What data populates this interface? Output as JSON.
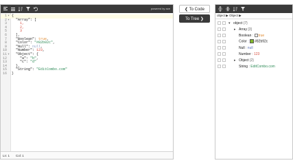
{
  "left": {
    "powered_by": "powered by ace",
    "code_lines": [
      {
        "num": "1",
        "fold": "▾",
        "parts": [
          {
            "t": "{",
            "c": "p"
          }
        ]
      },
      {
        "num": "2",
        "fold": "▾",
        "parts": [
          {
            "t": "  \"Array\": [",
            "c": "k"
          }
        ]
      },
      {
        "num": "3",
        "fold": "",
        "parts": [
          {
            "t": "    1,",
            "c": "n"
          }
        ]
      },
      {
        "num": "4",
        "fold": "",
        "parts": [
          {
            "t": "    2,",
            "c": "n"
          }
        ]
      },
      {
        "num": "5",
        "fold": "",
        "parts": [
          {
            "t": "    3",
            "c": "n"
          }
        ]
      },
      {
        "num": "6",
        "fold": "",
        "parts": [
          {
            "t": "  ],",
            "c": "p"
          }
        ]
      },
      {
        "num": "7",
        "fold": "",
        "parts": [
          {
            "t": "  \"Boolean\": ",
            "c": "k"
          },
          {
            "t": "true",
            "c": "b"
          },
          {
            "t": ",",
            "c": "p"
          }
        ]
      },
      {
        "num": "8",
        "fold": "",
        "parts": [
          {
            "t": "  \"Color\": ",
            "c": "k"
          },
          {
            "t": "\"#82b92c\"",
            "c": "s"
          },
          {
            "t": ",",
            "c": "p"
          }
        ]
      },
      {
        "num": "9",
        "fold": "",
        "parts": [
          {
            "t": "  \"Null\": ",
            "c": "k"
          },
          {
            "t": "null",
            "c": "nl"
          },
          {
            "t": ",",
            "c": "p"
          }
        ]
      },
      {
        "num": "10",
        "fold": "",
        "parts": [
          {
            "t": "  \"Number\": ",
            "c": "k"
          },
          {
            "t": "123",
            "c": "n"
          },
          {
            "t": ",",
            "c": "p"
          }
        ]
      },
      {
        "num": "11",
        "fold": "▾",
        "parts": [
          {
            "t": "  \"Object\": {",
            "c": "k"
          }
        ]
      },
      {
        "num": "12",
        "fold": "",
        "parts": [
          {
            "t": "    \"a\": ",
            "c": "k"
          },
          {
            "t": "\"b\"",
            "c": "s"
          },
          {
            "t": ",",
            "c": "p"
          }
        ]
      },
      {
        "num": "13",
        "fold": "",
        "parts": [
          {
            "t": "    \"c\": ",
            "c": "k"
          },
          {
            "t": "\"d\"",
            "c": "s"
          }
        ]
      },
      {
        "num": "14",
        "fold": "",
        "parts": [
          {
            "t": "  },",
            "c": "p"
          }
        ]
      },
      {
        "num": "15",
        "fold": "",
        "parts": [
          {
            "t": "  \"String\": ",
            "c": "k"
          },
          {
            "t": "\"EditCombo.com\"",
            "c": "s"
          }
        ]
      },
      {
        "num": "16",
        "fold": "",
        "parts": [
          {
            "t": "}",
            "c": "p"
          }
        ]
      }
    ],
    "status": {
      "line": "Ln: 1",
      "col": "Col: 1"
    }
  },
  "buttons": {
    "to_code": "❮ To Code",
    "to_tree": "To Tree ❯"
  },
  "right": {
    "breadcrumb": "object ▶ Object ▶",
    "rows": [
      {
        "indent": 0,
        "expander": "▾",
        "key": "object",
        "sep": " ",
        "val": "{7}",
        "vc": "t-sep"
      },
      {
        "indent": 1,
        "expander": "▸",
        "key": "Array",
        "sep": " ",
        "val": "[3]",
        "vc": "t-sep"
      },
      {
        "indent": 1,
        "expander": "",
        "key": "Boolean",
        "sep": " : ",
        "val": "true",
        "vc": "t-bool",
        "checkbox": true
      },
      {
        "indent": 1,
        "expander": "",
        "key": "Color",
        "sep": " : ",
        "val": "#82b92c",
        "vc": "t-color",
        "swatch": "#82b92c"
      },
      {
        "indent": 1,
        "expander": "",
        "key": "Null",
        "sep": " : ",
        "val": "null",
        "vc": "t-null"
      },
      {
        "indent": 1,
        "expander": "",
        "key": "Number",
        "sep": " : ",
        "val": "123",
        "vc": "t-num"
      },
      {
        "indent": 1,
        "expander": "▸",
        "key": "Object",
        "sep": " ",
        "val": "{2}",
        "vc": "t-sep"
      },
      {
        "indent": 1,
        "expander": "",
        "key": "String",
        "sep": " : ",
        "val": "EditCombo.com",
        "vc": "t-str"
      }
    ]
  }
}
